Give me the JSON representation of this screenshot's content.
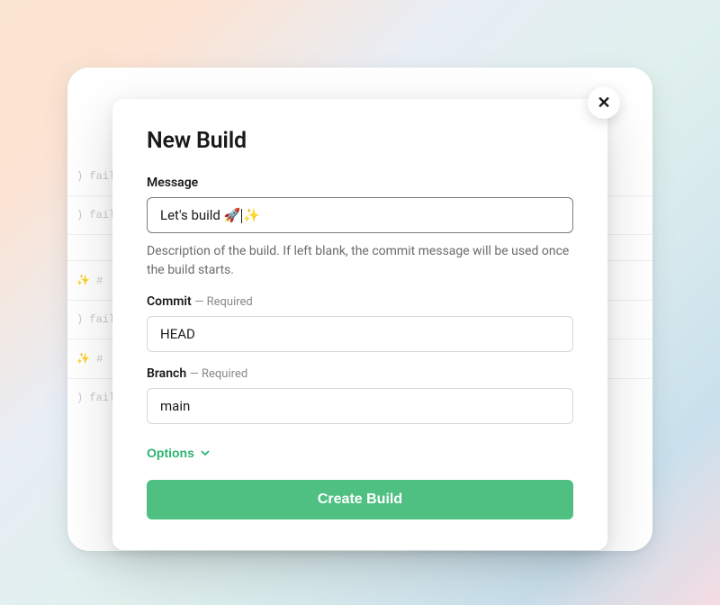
{
  "modal": {
    "title": "New Build",
    "message": {
      "label": "Message",
      "value_pre": "Let's build 🚀",
      "value_post": "✨",
      "help": "Description of the build. If left blank, the commit message will be used once the build starts."
    },
    "commit": {
      "label": "Commit",
      "required": "— Required",
      "value": "HEAD"
    },
    "branch": {
      "label": "Branch",
      "required": "— Required",
      "value": "main"
    },
    "options_label": "Options",
    "submit_label": "Create Build",
    "close_label": "✕"
  },
  "background": {
    "rows": [
      ") faild",
      ") faild",
      " ",
      "✨  #",
      ") faild",
      "✨  #",
      ") faild"
    ]
  }
}
